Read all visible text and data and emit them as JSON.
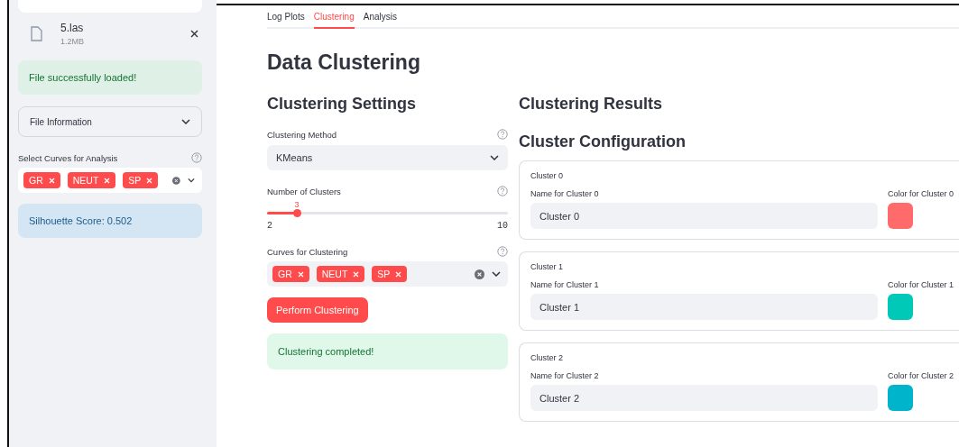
{
  "sidebar": {
    "file": {
      "name": "5.las",
      "size": "1.2MB"
    },
    "success_message": "File successfully loaded!",
    "expander": {
      "label": "File Information",
      "expanded": false
    },
    "curve_select": {
      "label": "Select Curves for Analysis",
      "tags": [
        "GR",
        "NEUT",
        "SP"
      ]
    },
    "info_message": "Silhouette Score: 0.502"
  },
  "tabs": [
    {
      "label": "Log Plots",
      "selected": false
    },
    {
      "label": "Clustering",
      "selected": true
    },
    {
      "label": "Analysis",
      "selected": false
    }
  ],
  "main": {
    "title": "Data Clustering",
    "settings": {
      "heading": "Clustering Settings",
      "method": {
        "label": "Clustering Method",
        "value": "KMeans"
      },
      "clusters": {
        "label": "Number of Clusters",
        "value": "3",
        "min": "2",
        "max": "10",
        "level": 0.125
      },
      "curves": {
        "label": "Curves for Clustering",
        "tags": [
          "GR",
          "NEUT",
          "SP"
        ]
      },
      "button": "Perform Clustering",
      "success_message": "Clustering completed!"
    },
    "results": {
      "heading": "Clustering Results",
      "config_heading": "Cluster Configuration",
      "clusters": [
        {
          "title": "Cluster 0",
          "name_label": "Name for Cluster 0",
          "name_value": "Cluster 0",
          "color_label": "Color for Cluster 0",
          "color": "#ff6b6b"
        },
        {
          "title": "Cluster 1",
          "name_label": "Name for Cluster 1",
          "name_value": "Cluster 1",
          "color_label": "Color for Cluster 1",
          "color": "#00c9b7"
        },
        {
          "title": "Cluster 2",
          "name_label": "Name for Cluster 2",
          "name_value": "Cluster 2",
          "color_label": "Color for Cluster 2",
          "color": "#00b4cc"
        }
      ]
    }
  }
}
